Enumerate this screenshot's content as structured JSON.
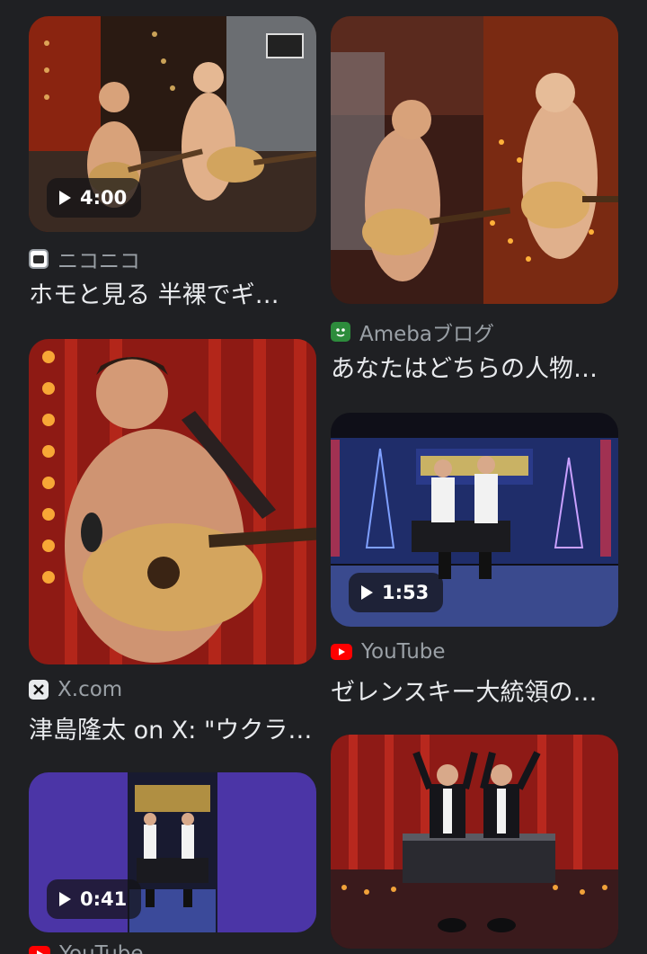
{
  "results": [
    {
      "source": "ニコニコ",
      "title": "ホモと見る 半裸でギ…",
      "duration": "4:00",
      "favicon": "niconico-icon"
    },
    {
      "source": "Amebaブログ",
      "title": "あなたはどちらの人物…",
      "duration": "",
      "favicon": "ameba-icon"
    },
    {
      "source": "X.com",
      "title": "津島隆太 on X: \"ウクラ…",
      "duration": "",
      "favicon": "x-icon"
    },
    {
      "source": "YouTube",
      "title": "ゼレンスキー大統領の…",
      "duration": "1:53",
      "favicon": "youtube-icon"
    },
    {
      "source": "YouTube",
      "title": "",
      "duration": "0:41",
      "favicon": "youtube-icon"
    },
    {
      "source": "",
      "title": "",
      "duration": "",
      "favicon": ""
    }
  ],
  "colors": {
    "background": "#1f2023",
    "source_text": "#9aa0a6",
    "title_text": "#e8eaed",
    "youtube_red": "#ff0000",
    "ameba_green": "#2d8c3c"
  }
}
